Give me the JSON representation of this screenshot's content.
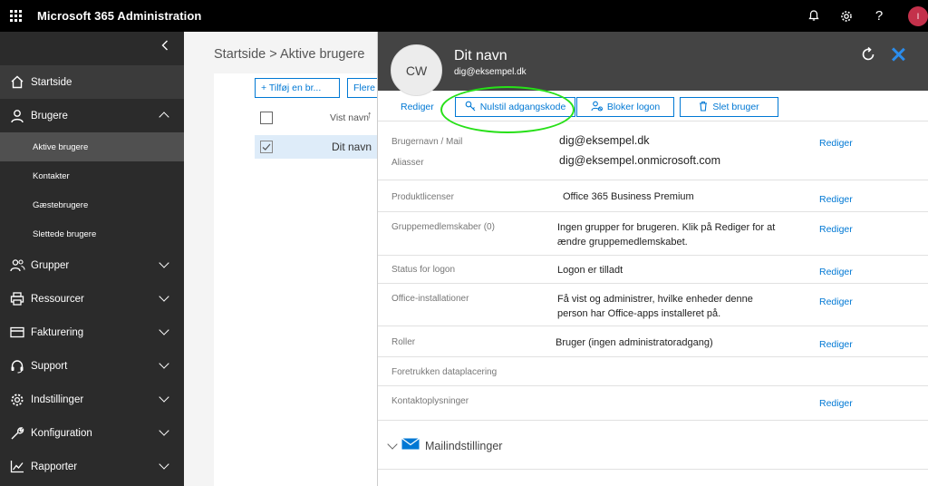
{
  "topbar": {
    "title": "Microsoft 365 Administration",
    "icons": [
      "bell-icon",
      "gear-icon",
      "help-icon"
    ],
    "user_initial": "I",
    "user_color": "#c4314b"
  },
  "sidebar": {
    "items": [
      {
        "label": "Startside",
        "icon": "home-icon"
      },
      {
        "label": "Brugere",
        "icon": "user-icon"
      },
      {
        "label": "Grupper",
        "icon": "group-icon"
      },
      {
        "label": "Ressourcer",
        "icon": "printer-icon"
      },
      {
        "label": "Fakturering",
        "icon": "card-icon"
      },
      {
        "label": "Support",
        "icon": "headset-icon"
      },
      {
        "label": "Indstillinger",
        "icon": "gear-icon"
      },
      {
        "label": "Konfiguration",
        "icon": "wrench-icon"
      },
      {
        "label": "Rapporter",
        "icon": "chart-icon"
      }
    ],
    "subitems": [
      "Aktive brugere",
      "Kontakter",
      "Gæstebrugere",
      "Slettede brugere"
    ]
  },
  "main": {
    "breadcrumb": "Startside > Aktive brugere",
    "add_user": "+ Tilføj en br...",
    "more": "Flere",
    "column_header": "Vist navn",
    "row_name": "Dit navn"
  },
  "panel": {
    "avatar_initials": "CW",
    "name": "Dit navn",
    "email": "dig@eksempel.dk",
    "actions": {
      "edit": "Rediger",
      "reset_password": "Nulstil adgangskode",
      "block_logon": "Bloker logon",
      "delete_user": "Slet bruger"
    },
    "rows": {
      "username_label": "Brugernavn / Mail",
      "username_value": "dig@eksempel.dk",
      "aliases_label": "Aliasser",
      "aliases_value": "dig@eksempel.onmicrosoft.com",
      "licenses_label": "Produktlicenser",
      "licenses_value": "Office 365 Business Premium",
      "groups_label": "Gruppemedlemskaber (0)",
      "groups_value": "Ingen grupper for brugeren. Klik på Rediger for at ændre gruppemedlemskabet.",
      "status_label": "Status for logon",
      "status_value": "Logon er tilladt",
      "office_label": "Office-installationer",
      "office_value": "Få vist og administrer, hvilke enheder denne person har Office-apps installeret på.",
      "roles_label": "Roller",
      "roles_value": "Bruger (ingen administratoradgang)",
      "data_location_label": "Foretrukken dataplacering",
      "contact_label": "Kontaktoplysninger",
      "edit_link": "Rediger"
    },
    "mail_settings": "Mailindstillinger"
  },
  "colors": {
    "accent": "#0078d4",
    "highlight": "#27e018",
    "topbar": "#000000",
    "sidebar": "#2b2b2b",
    "panel_header": "#444444"
  }
}
